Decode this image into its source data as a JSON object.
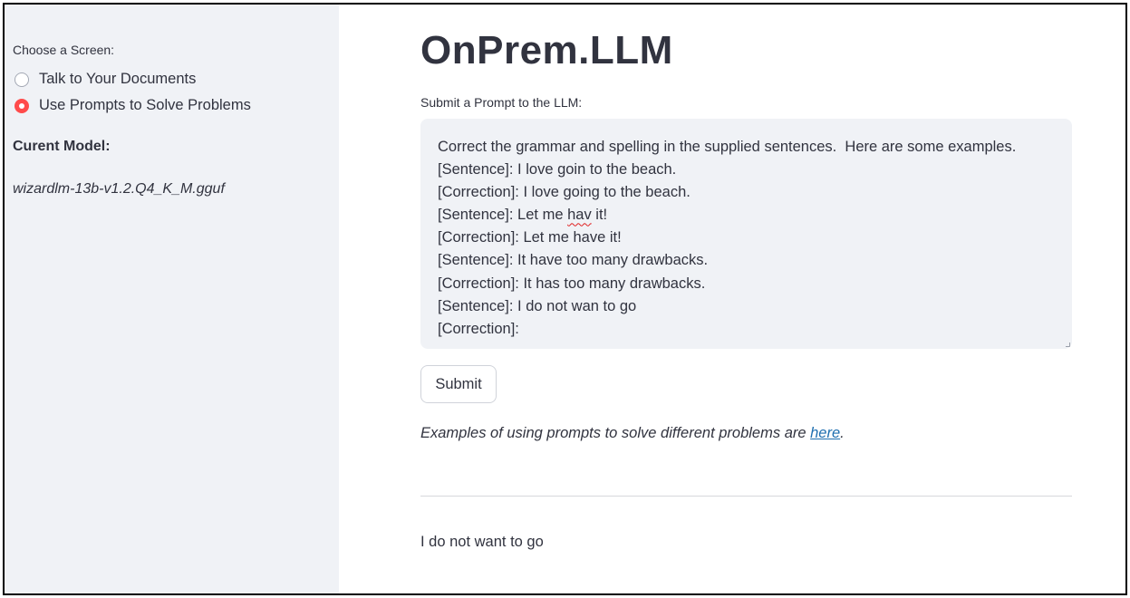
{
  "sidebar": {
    "choose_label": "Choose a Screen:",
    "options": [
      {
        "label": "Talk to Your Documents",
        "selected": false
      },
      {
        "label": "Use Prompts to Solve Problems",
        "selected": true
      }
    ],
    "model_label": "Curent Model:",
    "model_value": "wizardlm-13b-v1.2.Q4_K_M.gguf"
  },
  "main": {
    "title": "OnPrem.LLM",
    "prompt_label": "Submit a Prompt to the LLM:",
    "prompt_lines": {
      "l0": "Correct the grammar and spelling in the supplied sentences.  Here are some examples.",
      "l1": "[Sentence]: I love goin to the beach.",
      "l2": "[Correction]: I love going to the beach.",
      "l3_pre": "[Sentence]: Let me ",
      "l3_misspelled": "hav",
      "l3_post": " it!",
      "l4": "[Correction]: Let me have it!",
      "l5": "[Sentence]: It have too many drawbacks.",
      "l6": "[Correction]: It has too many drawbacks.",
      "l7": "[Sentence]: I do not wan to go",
      "l8": "[Correction]:"
    },
    "submit_label": "Submit",
    "examples_text": "Examples of using prompts to solve different problems are ",
    "examples_link": "here",
    "examples_end": ".",
    "result": "I do not want to go"
  },
  "colors": {
    "sidebar_bg": "#f0f2f6",
    "accent": "#ff4b4b",
    "text": "#31333f",
    "link": "#1f6fb0"
  }
}
